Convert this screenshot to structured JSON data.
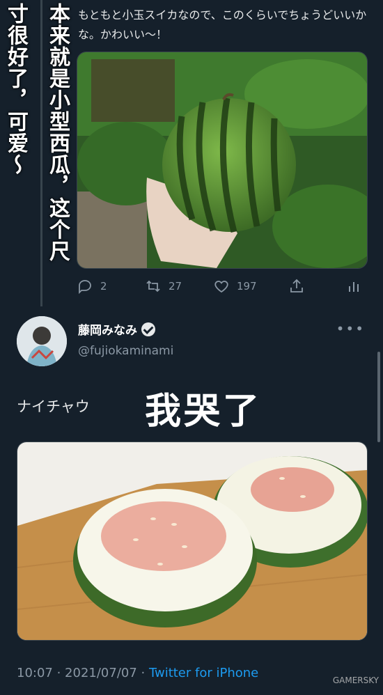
{
  "overlay": {
    "col1": "寸很好了，可爱～",
    "col2": "本来就是小型西瓜，这个尺"
  },
  "tweet1": {
    "text": "もともと小玉スイカなので、このくらいでちょうどいいかな。かわいい〜！",
    "actions": {
      "replies": "2",
      "retweets": "27",
      "likes": "197"
    }
  },
  "tweet2": {
    "display_name": "藤岡みなみ",
    "handle": "@fujiokaminami",
    "text": "ナイチャウ",
    "overlay_caption": "我哭了",
    "timestamp": "10:07 · 2021/07/07 · ",
    "source": "Twitter for iPhone"
  },
  "watermark": "GAMERSKY",
  "icons": [
    "reply-icon",
    "retweet-icon",
    "like-icon",
    "share-icon",
    "analytics-icon",
    "verified-icon",
    "more-icon"
  ],
  "colors": {
    "background": "#15202b",
    "link": "#1d9bf0",
    "muted": "#8b98a5"
  }
}
